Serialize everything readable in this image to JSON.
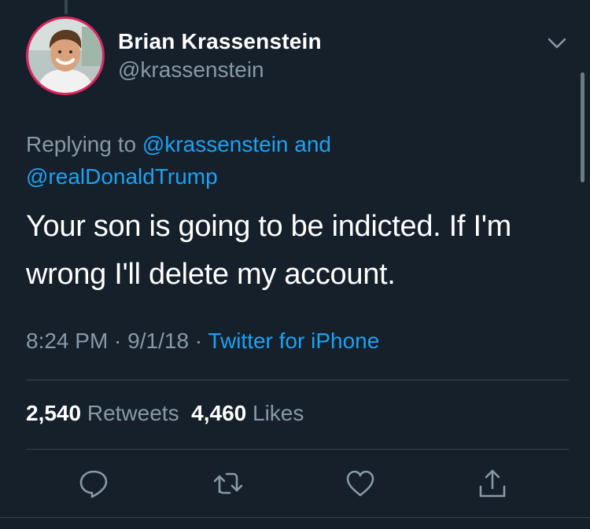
{
  "colors": {
    "background": "#15202b",
    "primary_text": "#ffffff",
    "secondary_text": "#8899a6",
    "link": "#1da1f2",
    "divider": "#38444d",
    "avatar_ring": "#e0245e"
  },
  "tweet": {
    "author_name": "Brian Krassenstein",
    "author_handle": "@krassenstein",
    "replying_prefix": "Replying to ",
    "reply_mention_1": "@krassenstein",
    "reply_and": " and",
    "reply_mention_2": "@realDonaldTrump",
    "text": "Your son is going to be indicted. If I'm wrong I'll delete my account.",
    "time": "8:24 PM",
    "date_sep": " · ",
    "date": "9/1/18",
    "source_sep": " · ",
    "source": "Twitter for iPhone"
  },
  "stats": {
    "retweets_count": "2,540",
    "retweets_label": "Retweets",
    "likes_count": "4,460",
    "likes_label": "Likes"
  },
  "icons": {
    "options": "chevron-down-icon",
    "reply": "reply-icon",
    "retweet": "retweet-icon",
    "like": "heart-icon",
    "share": "share-icon"
  }
}
